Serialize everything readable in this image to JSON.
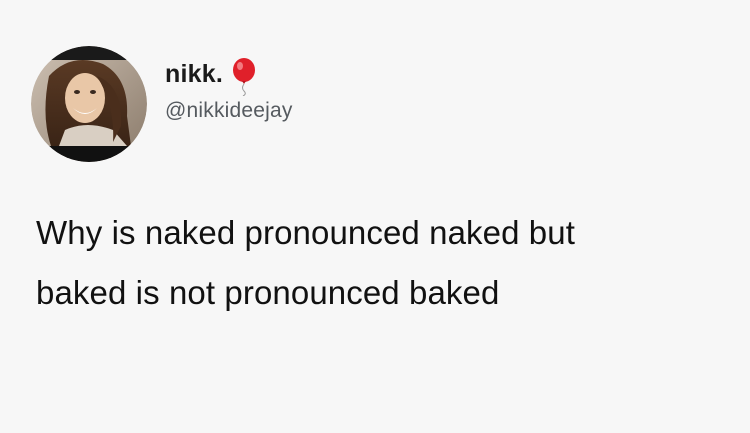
{
  "tweet": {
    "author": {
      "display_name": "nikk.",
      "name_emoji_icon": "balloon-icon",
      "handle": "@nikkideejay",
      "avatar_icon": "profile-photo"
    },
    "text_lines": [
      "Why is naked pronounced naked but",
      "baked is not pronounced baked"
    ]
  },
  "colors": {
    "background": "#f7f7f7",
    "text": "#111111",
    "handle": "#555a5f",
    "balloon": "#e0202a"
  }
}
